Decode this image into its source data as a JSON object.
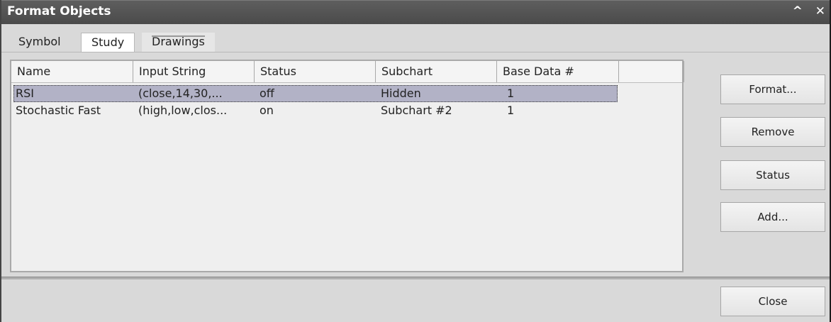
{
  "window": {
    "title": "Format Objects",
    "controls": [
      "^",
      "✕"
    ]
  },
  "tabs": [
    {
      "label": "Symbol",
      "active": false
    },
    {
      "label": "Study",
      "active": true
    },
    {
      "label": "Drawings",
      "active": false
    }
  ],
  "table": {
    "columns": [
      "Name",
      "Input String",
      "Status",
      "Subchart",
      "Base Data #",
      ""
    ],
    "rows": [
      {
        "name": "RSI",
        "input": "(close,14,30,...",
        "status": "off",
        "subchart": "Hidden",
        "base": "1",
        "selected": true
      },
      {
        "name": "Stochastic Fast",
        "input": "(high,low,clos...",
        "status": "on",
        "subchart": "Subchart #2",
        "base": "1",
        "selected": false
      }
    ]
  },
  "buttons": {
    "format": "Format...",
    "remove": "Remove",
    "status": "Status",
    "add": "Add...",
    "close": "Close"
  }
}
